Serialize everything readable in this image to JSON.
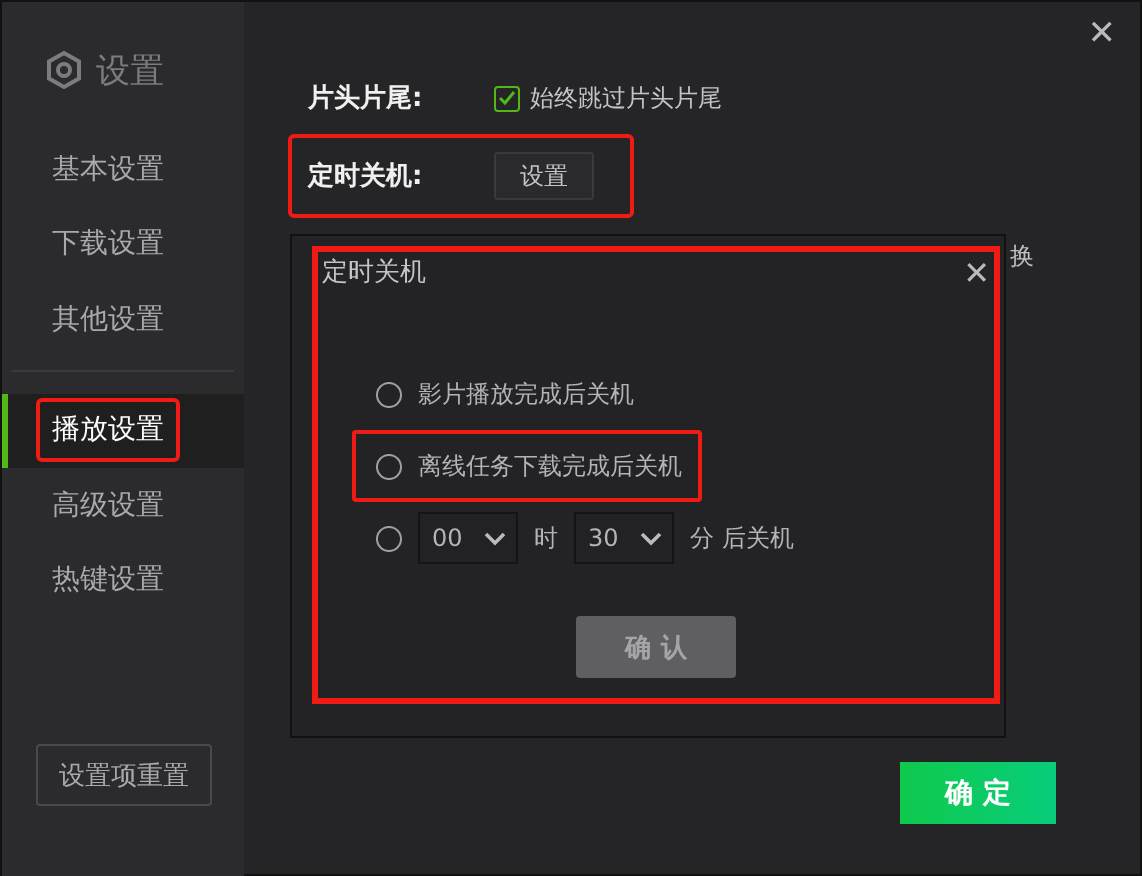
{
  "sidebar": {
    "title": "设置",
    "items": [
      {
        "label": "基本设置",
        "selected": false,
        "highlighted": false
      },
      {
        "label": "下载设置",
        "selected": false,
        "highlighted": false
      },
      {
        "label": "其他设置",
        "selected": false,
        "highlighted": false
      },
      {
        "label": "播放设置",
        "selected": true,
        "highlighted": true
      },
      {
        "label": "高级设置",
        "selected": false,
        "highlighted": false
      },
      {
        "label": "热键设置",
        "selected": false,
        "highlighted": false
      }
    ],
    "reset_button": "设置项重置"
  },
  "settings": [
    {
      "kind": "checkbox",
      "label": "片头片尾:",
      "option": "始终跳过片头片尾",
      "checked": true,
      "highlighted": false
    },
    {
      "kind": "button",
      "label": "定时关机:",
      "button": "设置",
      "highlighted": true
    }
  ],
  "obscured_text": "换",
  "dialog": {
    "title": "定时关机",
    "close": "✕",
    "options": [
      {
        "kind": "text",
        "label": "影片播放完成后关机",
        "selected": false,
        "highlighted": false
      },
      {
        "kind": "text",
        "label": "离线任务下载完成后关机",
        "selected": false,
        "highlighted": true
      },
      {
        "kind": "time",
        "hour": "00",
        "hour_unit": "时",
        "minute": "30",
        "minute_unit": "分",
        "suffix": "后关机",
        "selected": false,
        "highlighted": false
      }
    ],
    "confirm": "确 认",
    "highlighted": true
  },
  "close": "✕",
  "ok_button": "确 定"
}
